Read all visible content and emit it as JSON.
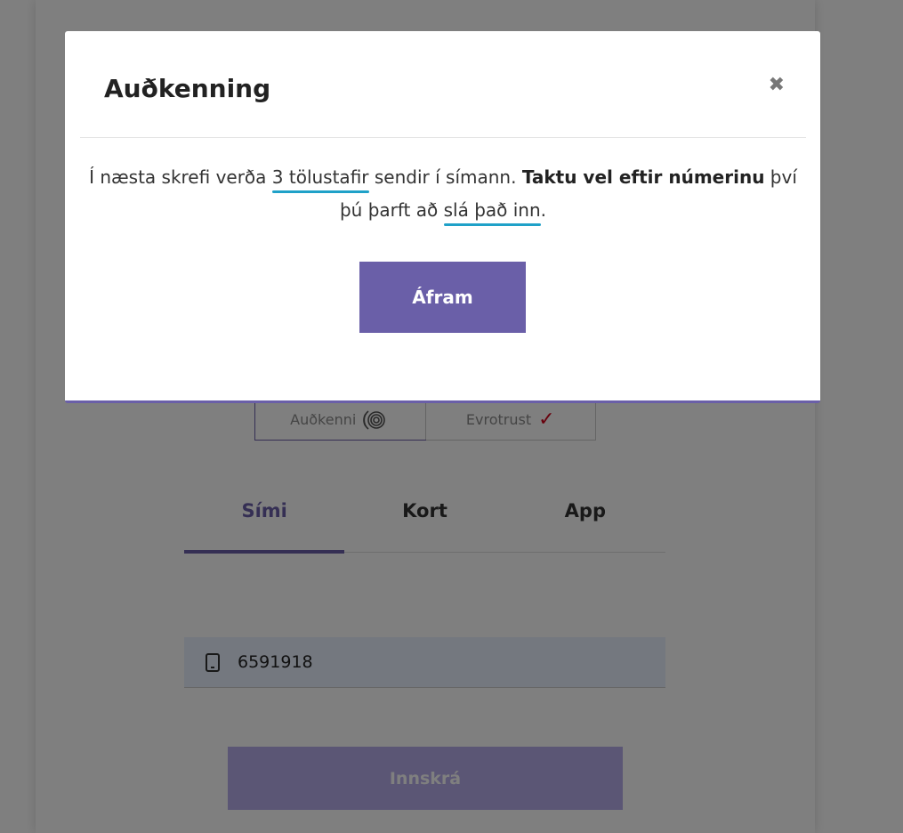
{
  "modal": {
    "title": "Auðkenning",
    "close_icon": "close-icon",
    "text_1": "Í næsta skrefi verða ",
    "highlight_1": "3 tölustafir",
    "text_2": " sendir í símann. ",
    "bold": "Taktu vel eftir númerinu",
    "text_3": " því þú þarft að ",
    "highlight_2": "slá það inn",
    "text_4": ".",
    "continue_label": "Áfram"
  },
  "providers": [
    {
      "label": "Auðkenni",
      "icon": "fingerprint-icon",
      "active": true
    },
    {
      "label": "Evrotrust",
      "icon": "check-icon",
      "active": false
    }
  ],
  "tabs": [
    {
      "label": "Sími",
      "active": true
    },
    {
      "label": "Kort",
      "active": false
    },
    {
      "label": "App",
      "active": false
    }
  ],
  "phone": {
    "icon": "mobile-phone-icon",
    "value": "6591918"
  },
  "login_label": "Innskrá",
  "colors": {
    "accent": "#6a5fa8",
    "underline": "#1fa1c8",
    "check": "#d0021b",
    "overlay": "rgba(0,0,0,0.5)"
  }
}
